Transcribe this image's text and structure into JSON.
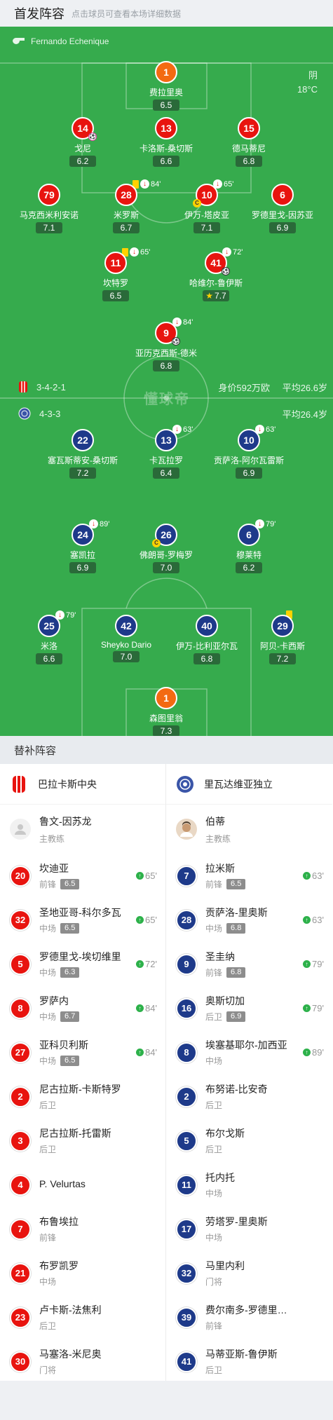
{
  "header": {
    "title": "首发阵容",
    "subtitle": "点击球员可查看本场详细数据"
  },
  "match": {
    "referee": "Fernando Echenique",
    "weather": "阴",
    "temperature": "18°C"
  },
  "home": {
    "formation": "3-4-2-1",
    "value": "身价592万欧",
    "avg_age": "平均26.6岁",
    "name": "巴拉卡斯中央",
    "coach": "鲁文-因苏龙",
    "coach_role": "主教练"
  },
  "away": {
    "formation": "4-3-3",
    "avg_age": "平均26.4岁",
    "name": "里瓦达维亚独立",
    "coach": "伯蒂",
    "coach_role": "主教练"
  },
  "watermark": "懂球帝",
  "home_xi": [
    {
      "num": "1",
      "name": "费拉里奥",
      "rating": "6.5"
    },
    {
      "num": "14",
      "name": "戈尼",
      "rating": "6.2"
    },
    {
      "num": "13",
      "name": "卡洛斯-桑切斯",
      "rating": "6.6"
    },
    {
      "num": "15",
      "name": "德马蒂尼",
      "rating": "6.8"
    },
    {
      "num": "79",
      "name": "马克西米利安诺",
      "rating": "7.1"
    },
    {
      "num": "28",
      "name": "米罗斯",
      "rating": "6.7",
      "time": "84'"
    },
    {
      "num": "10",
      "name": "伊万-塔皮亚",
      "rating": "7.1",
      "time": "65'"
    },
    {
      "num": "6",
      "name": "罗德里戈-因苏亚",
      "rating": "6.9"
    },
    {
      "num": "11",
      "name": "坎特罗",
      "rating": "6.5",
      "time": "65'"
    },
    {
      "num": "41",
      "name": "哈维尔-鲁伊斯",
      "rating": "7.7",
      "time": "72'"
    },
    {
      "num": "9",
      "name": "亚历克西斯-德米",
      "rating": "6.8",
      "time": "84'"
    }
  ],
  "away_xi": [
    {
      "num": "22",
      "name": "塞瓦斯蒂安-桑切斯",
      "rating": "7.2"
    },
    {
      "num": "13",
      "name": "卡瓦拉罗",
      "rating": "6.4",
      "time": "63'"
    },
    {
      "num": "10",
      "name": "贡萨洛-阿尔瓦雷斯",
      "rating": "6.9",
      "time": "63'"
    },
    {
      "num": "24",
      "name": "塞凯拉",
      "rating": "6.9",
      "time": "89'"
    },
    {
      "num": "26",
      "name": "佛朗哥-罗梅罗",
      "rating": "7.0"
    },
    {
      "num": "6",
      "name": "穆莱特",
      "rating": "6.2",
      "time": "79'"
    },
    {
      "num": "25",
      "name": "米洛",
      "rating": "6.6",
      "time": "79'"
    },
    {
      "num": "42",
      "name": "Sheyko Dario",
      "rating": "7.0"
    },
    {
      "num": "40",
      "name": "伊万-比利亚尔瓦",
      "rating": "6.8"
    },
    {
      "num": "29",
      "name": "阿贝-卡西斯",
      "rating": "7.2"
    },
    {
      "num": "1",
      "name": "森图里翁",
      "rating": "7.3"
    }
  ],
  "subs_title": "替补阵容",
  "home_subs": [
    {
      "num": "20",
      "name": "坎迪亚",
      "pos": "前锋",
      "rating": "6.5",
      "time": "65'"
    },
    {
      "num": "32",
      "name": "圣地亚哥-科尔多瓦",
      "pos": "中场",
      "rating": "6.5",
      "time": "65'"
    },
    {
      "num": "5",
      "name": "罗德里戈-埃切维里",
      "pos": "中场",
      "rating": "6.3",
      "time": "72'"
    },
    {
      "num": "8",
      "name": "罗萨内",
      "pos": "中场",
      "rating": "6.7",
      "time": "84'"
    },
    {
      "num": "27",
      "name": "亚科贝利斯",
      "pos": "中场",
      "rating": "6.5",
      "time": "84'"
    },
    {
      "num": "2",
      "name": "尼古拉斯-卡斯特罗",
      "pos": "后卫"
    },
    {
      "num": "3",
      "name": "尼古拉斯-托雷斯",
      "pos": "后卫"
    },
    {
      "num": "4",
      "name": "P. Velurtas",
      "pos": ""
    },
    {
      "num": "7",
      "name": "布鲁埃拉",
      "pos": "前锋"
    },
    {
      "num": "21",
      "name": "布罗凯罗",
      "pos": "中场"
    },
    {
      "num": "23",
      "name": "卢卡斯-法焦利",
      "pos": "后卫"
    },
    {
      "num": "30",
      "name": "马塞洛-米尼奥",
      "pos": "门将"
    }
  ],
  "away_subs": [
    {
      "num": "7",
      "name": "拉米斯",
      "pos": "前锋",
      "rating": "6.5",
      "time": "63'"
    },
    {
      "num": "28",
      "name": "贡萨洛-里奥斯",
      "pos": "中场",
      "rating": "6.8",
      "time": "63'"
    },
    {
      "num": "9",
      "name": "圣圭纳",
      "pos": "前锋",
      "rating": "6.8",
      "time": "79'"
    },
    {
      "num": "16",
      "name": "奥斯切加",
      "pos": "后卫",
      "rating": "6.9",
      "time": "79'"
    },
    {
      "num": "8",
      "name": "埃塞基耶尔-加西亚",
      "pos": "中场",
      "time": "89'"
    },
    {
      "num": "2",
      "name": "布努诺-比安奇",
      "pos": "后卫"
    },
    {
      "num": "5",
      "name": "布尔戈斯",
      "pos": "后卫"
    },
    {
      "num": "11",
      "name": "托内托",
      "pos": "中场"
    },
    {
      "num": "17",
      "name": "劳塔罗-里奥斯",
      "pos": "中场"
    },
    {
      "num": "32",
      "name": "马里内利",
      "pos": "门将"
    },
    {
      "num": "39",
      "name": "费尔南多-罗德里格斯",
      "pos": "前锋"
    },
    {
      "num": "41",
      "name": "马蒂亚斯-鲁伊斯",
      "pos": "后卫"
    }
  ]
}
